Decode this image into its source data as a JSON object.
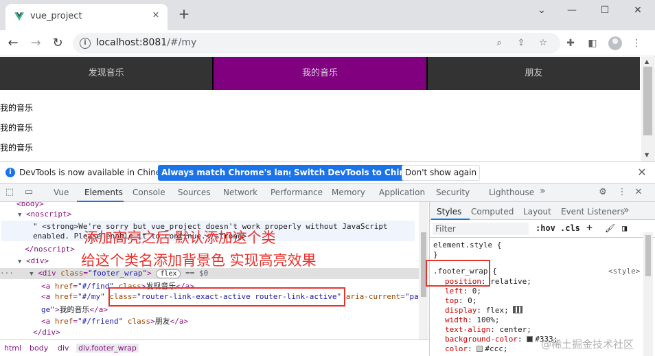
{
  "browser": {
    "tab_title": "vue_project",
    "url_host": "localhost:8081",
    "url_path": "/#/my",
    "new_tab_glyph": "+",
    "icons": [
      "vue-favicon-icon",
      "close-icon",
      "plus-icon",
      "minimize-icon",
      "maximize-icon",
      "window-close-icon",
      "back-icon",
      "forward-icon",
      "reload-icon",
      "info-icon",
      "zoom-icon",
      "share-icon",
      "star-icon",
      "extensions-icon",
      "side-panel-icon",
      "profile-avatar",
      "menu-kebab-icon"
    ]
  },
  "page": {
    "nav": [
      {
        "label": "发现音乐",
        "active": false
      },
      {
        "label": "我的音乐",
        "active": true
      },
      {
        "label": "朋友",
        "active": false
      }
    ],
    "lines": [
      "我的音乐",
      "我的音乐",
      "我的音乐"
    ],
    "colors": {
      "nav_bg": "#333333",
      "active_bg": "#800080",
      "nav_text": "#cccccc"
    }
  },
  "infobar": {
    "message": "DevTools is now available in Chinese!",
    "btn_match": "Always match Chrome's language",
    "btn_switch": "Switch DevTools to Chinese",
    "btn_dismiss": "Don't show again"
  },
  "devtools": {
    "tabs": [
      "Vue",
      "Elements",
      "Console",
      "Sources",
      "Network",
      "Performance",
      "Memory",
      "Application",
      "Security",
      "Lighthouse"
    ],
    "active_tab": "Elements",
    "more": "»"
  },
  "elements": {
    "body_tag": "<body>",
    "noscript_open": "<noscript>",
    "noscript_text_1": "\" <strong>We're sorry but vue_project doesn't work properly without JavaScript",
    "noscript_text_2": "enabled. Please enable it to continue.</strong>",
    "noscript_close": "</noscript>",
    "div_open": "<div>",
    "footer_div_tag": "<div",
    "footer_div_attr": "class",
    "footer_div_val": "\"footer_wrap\"",
    "footer_div_end": ">",
    "flex_badge": "flex",
    "dollar": "== $0",
    "link1_pre": "<a",
    "link1_href_attr": "href",
    "link1_href": "\"#/find\"",
    "link1_class": "class",
    "link1_text": "发现音乐",
    "link1_close": "</a>",
    "link2_pre": "<a",
    "link2_href_attr": "href",
    "link2_href": "\"#/my\"",
    "link2_class_attr": "class",
    "link2_class_val": "\"router-link-exact-active router-link-active\"",
    "link2_aria": "aria-current",
    "link2_aria_val": "\"pa",
    "link2_cont": "ge\"",
    "link2_text": "我的音乐",
    "link2_close": "</a>",
    "link3_pre": "<a",
    "link3_href_attr": "href",
    "link3_href": "\"#/friend\"",
    "link3_class": "class",
    "link3_text": "朋友",
    "link3_close": "</a>",
    "div_close": "</div>"
  },
  "breadcrumbs": [
    "html",
    "body",
    "div",
    "div.footer_wrap"
  ],
  "styles": {
    "tabs": [
      "Styles",
      "Computed",
      "Layout",
      "Event Listeners"
    ],
    "more": "»",
    "filter_placeholder": "Filter",
    "hov": ":hov",
    "cls": ".cls",
    "element_style": "element.style {",
    "close_brace": "}",
    "selector": ".footer_wrap",
    "brace_open": "{",
    "source": "<style>",
    "props": [
      {
        "name": "position",
        "value": "relative;"
      },
      {
        "name": "left",
        "value": "0;"
      },
      {
        "name": "top",
        "value": "0;"
      },
      {
        "name": "display",
        "value": "flex;"
      },
      {
        "name": "width",
        "value": "100%;"
      },
      {
        "name": "text-align",
        "value": "center;"
      },
      {
        "name": "background-color",
        "value": "#333;"
      },
      {
        "name": "color",
        "value": "#ccc;"
      }
    ],
    "swatch_colors": {
      "bg": "#333333",
      "fg": "#cccccc"
    }
  },
  "annotations": {
    "line1": "添加高亮之后 默认添加这个类",
    "line2": "给这个类名添加背景色 实现高亮效果",
    "color": "#e8322c"
  },
  "watermark": "@稀土掘金技术社区"
}
